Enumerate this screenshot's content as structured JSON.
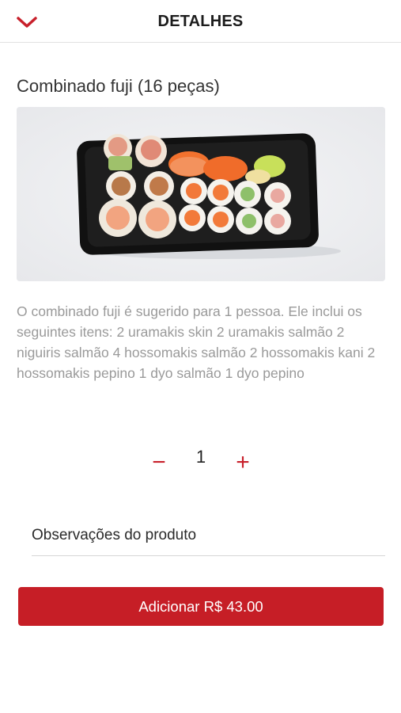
{
  "header": {
    "title": "DETALHES",
    "back_icon": "chevron-down-icon",
    "accent_color": "#c8202b"
  },
  "product": {
    "name": "Combinado fuji (16 peças)",
    "image_alt": "sushi-platter",
    "description": "O combinado fuji é sugerido para 1 pessoa. Ele inclui os seguintes itens: 2 uramakis skin 2 uramakis salmão 2 niguiris salmão 4 hossomakis salmão 2 hossomakis kani 2 hossomakis pepino 1 dyo salmão 1 dyo pepino"
  },
  "quantity": {
    "value": "1",
    "minus_label": "−",
    "plus_label": "+"
  },
  "notes": {
    "placeholder": "Observações do produto",
    "value": ""
  },
  "cta": {
    "label": "Adicionar R$ 43.00",
    "color": "#c61e26"
  }
}
